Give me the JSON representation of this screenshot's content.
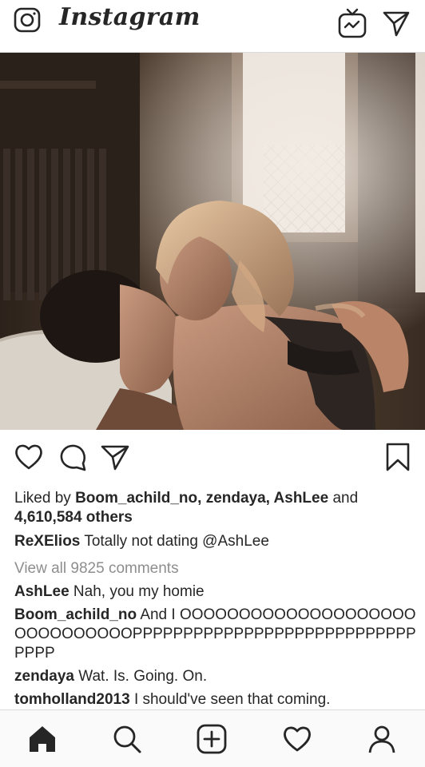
{
  "header": {
    "logo_text": "Instagram",
    "camera_icon": "camera-icon",
    "igtv_icon": "igtv-icon",
    "direct_icon": "paper-plane-icon"
  },
  "post": {
    "photo_alt": "",
    "actions": {
      "like_icon": "heart-outline-icon",
      "comment_icon": "comment-bubble-icon",
      "share_icon": "paper-plane-icon",
      "save_icon": "bookmark-icon"
    },
    "likes": {
      "prefix": "Liked by",
      "users": "Boom_achild_no, zendaya, AshLee",
      "and": "and",
      "others": "4,610,584 others"
    },
    "caption": {
      "username": "ReXElios",
      "text": "Totally not dating @AshLee"
    },
    "view_all_comments": "View all 9825 comments",
    "comments": [
      {
        "username": "AshLee",
        "text": "Nah, you my homie"
      },
      {
        "username": "Boom_achild_no",
        "text": "And I OOOOOOOOOOOOOOOOOOOOOOOOOOOOOOPPPPPPPPPPPPPPPPPPPPPPPPPPPPPPPP"
      },
      {
        "username": "zendaya",
        "text": "Wat. Is. Going. On."
      },
      {
        "username": "tomholland2013",
        "text": "I should've seen that coming."
      }
    ]
  },
  "bottom_nav": {
    "items": [
      "home-icon",
      "search-icon",
      "add-post-icon",
      "heart-activity-icon",
      "profile-icon"
    ]
  },
  "colors": {
    "text": "#262626",
    "muted": "#8e8e8e",
    "border": "#dbdbdb",
    "nav_bg": "#fafafa"
  }
}
